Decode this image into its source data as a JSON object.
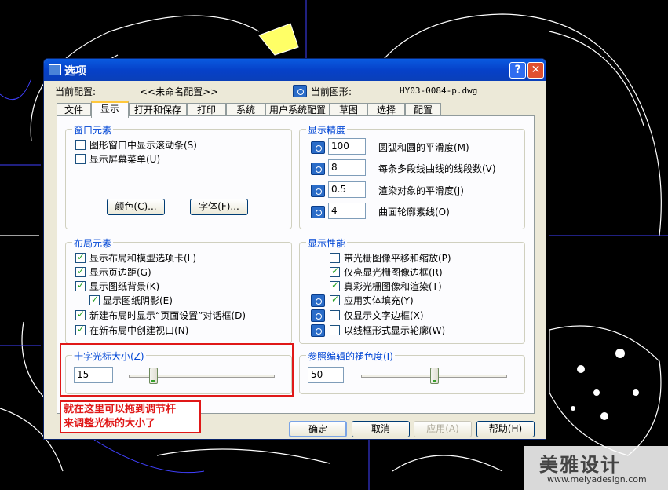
{
  "dialog": {
    "title": "选项",
    "help_glyph": "?",
    "close_glyph": "✕",
    "profile_label": "当前配置:",
    "profile_value": "<<未命名配置>>",
    "drawing_label": "当前图形:",
    "drawing_value": "HY03-0084-p.dwg",
    "tabs": [
      "文件",
      "显示",
      "打开和保存",
      "打印",
      "系统",
      "用户系统配置",
      "草图",
      "选择",
      "配置"
    ],
    "active_tab": "显示"
  },
  "window_elements": {
    "title": "窗口元素",
    "scrollbars": {
      "label": "图形窗口中显示滚动条(S)",
      "checked": false
    },
    "screen_menu": {
      "label": "显示屏幕菜单(U)",
      "checked": false
    },
    "colors_button": "颜色(C)...",
    "fonts_button": "字体(F)..."
  },
  "display_resolution": {
    "title": "显示精度",
    "rows": [
      {
        "value": "100",
        "label": "圆弧和圆的平滑度(M)"
      },
      {
        "value": "8",
        "label": "每条多段线曲线的线段数(V)"
      },
      {
        "value": "0.5",
        "label": "渲染对象的平滑度(J)"
      },
      {
        "value": "4",
        "label": "曲面轮廓素线(O)"
      }
    ]
  },
  "layout_elements": {
    "title": "布局元素",
    "items": [
      {
        "label": "显示布局和模型选项卡(L)",
        "checked": true
      },
      {
        "label": "显示页边距(G)",
        "checked": true
      },
      {
        "label": "显示图纸背景(K)",
        "checked": true
      },
      {
        "label": "显示图纸阴影(E)",
        "checked": true
      },
      {
        "label": "新建布局时显示“页面设置”对话框(D)",
        "checked": true
      },
      {
        "label": "在新布局中创建视口(N)",
        "checked": true
      }
    ]
  },
  "display_performance": {
    "title": "显示性能",
    "items": [
      {
        "label": "带光栅图像平移和缩放(P)",
        "checked": false
      },
      {
        "label": "仅亮显光栅图像边框(R)",
        "checked": true
      },
      {
        "label": "真彩光栅图像和渲染(T)",
        "checked": true
      },
      {
        "label": "应用实体填充(Y)",
        "checked": true
      },
      {
        "label": "仅显示文字边框(X)",
        "checked": false
      },
      {
        "label": "以线框形式显示轮廓(W)",
        "checked": false
      }
    ]
  },
  "crosshair": {
    "title": "十字光标大小(Z)",
    "value": "15",
    "level": 0.15
  },
  "xref_fade": {
    "title": "参照编辑的褪色度(I)",
    "value": "50",
    "level": 0.5
  },
  "annotation": {
    "line1": "就在这里可以拖到调节杆",
    "line2": "来调整光标的大小了"
  },
  "footer": {
    "ok": "确定",
    "cancel": "取消",
    "apply": "应用(A)",
    "help": "帮助(H)"
  },
  "watermark": {
    "brand": "美雅设计",
    "url": "www.meiyadesign.com"
  },
  "colors": {
    "cad_white": "#ffffff",
    "cad_blue": "#4040ff",
    "cad_yellow": "#ffff00",
    "annotation_red": "#e01818"
  }
}
